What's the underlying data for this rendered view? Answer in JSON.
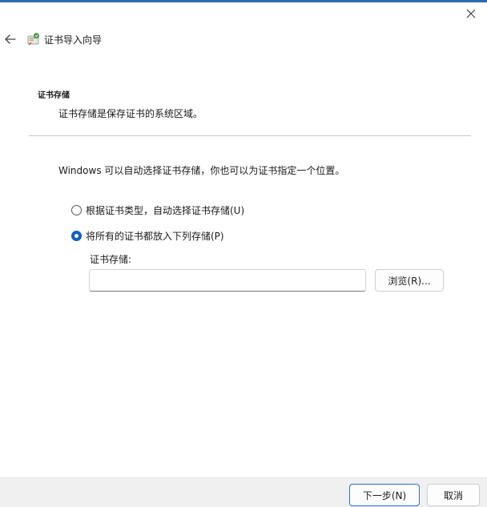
{
  "window": {
    "accent_color": "#2b6cb0",
    "close_icon": "close-icon"
  },
  "nav": {
    "back_icon": "arrow-left-icon",
    "wizard_icon": "certificate-icon",
    "title": "证书导入向导"
  },
  "section": {
    "heading": "证书存储",
    "description": "证书存储是保存证书的系统区域。"
  },
  "instruction": "Windows 可以自动选择证书存储，你也可以为证书指定一个位置。",
  "options": [
    {
      "label": "根据证书类型，自动选择证书存储(U)",
      "selected": false
    },
    {
      "label": "将所有的证书都放入下列存储(P)",
      "selected": true
    }
  ],
  "store": {
    "label": "证书存储:",
    "value": "",
    "browse_label": "浏览(R)..."
  },
  "footer": {
    "next_label": "下一步(N)",
    "cancel_label": "取消"
  }
}
